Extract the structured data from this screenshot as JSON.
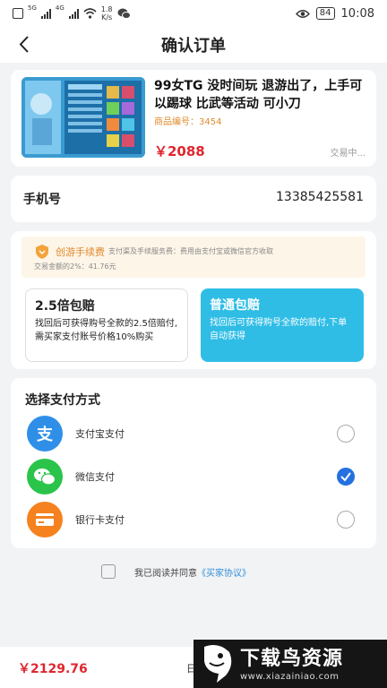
{
  "status_bar": {
    "network_tag_1": "5G",
    "network_tag_2": "4G",
    "speed_value": "1.8",
    "speed_unit": "K/s",
    "battery": "84",
    "time": "10:08"
  },
  "header": {
    "title": "确认订单"
  },
  "product": {
    "title": "99女TG 没时间玩 退游出了，上手可以踢球 比武等活动 可小刀",
    "code": "商品编号：3454",
    "price": "￥2088",
    "status": "交易中..."
  },
  "phone": {
    "label": "手机号",
    "value": "13385425581"
  },
  "fee": {
    "title": "创游手续费",
    "desc": "支付渠及手续服务费：费用由支付宝或微信官方收取",
    "line2": "交易金额的2%：41.76元"
  },
  "plans": [
    {
      "title": "2.5倍包赔",
      "desc": "找回后可获得购号全款的2.5倍赔付,需买家支付账号价格10%购买",
      "selected": false
    },
    {
      "title": "普通包赔",
      "desc": "找回后可获得购号全款的赔付,下单自动获得",
      "selected": true
    }
  ],
  "payment": {
    "heading": "选择支付方式",
    "options": [
      {
        "label": "支付宝支付",
        "icon": "alipay-icon",
        "color": "#2f8fe8",
        "checked": false
      },
      {
        "label": "微信支付",
        "icon": "wechat-icon",
        "color": "#2bc44a",
        "checked": true
      },
      {
        "label": "银行卡支付",
        "icon": "bank-card-icon",
        "color": "#f5821f",
        "checked": false
      }
    ]
  },
  "agreement": {
    "text": "我已阅读并同意",
    "link": "《买家协议》"
  },
  "bottom": {
    "total": "￥2129.76",
    "fragment": "日"
  },
  "watermark": {
    "title": "下载鸟资源",
    "url": "www.xiazainiao.com"
  },
  "colors": {
    "price_red": "#e0262f",
    "accent_orange": "#e08a2c",
    "plan_blue": "#2fbde6",
    "radio_blue": "#2470e0"
  }
}
